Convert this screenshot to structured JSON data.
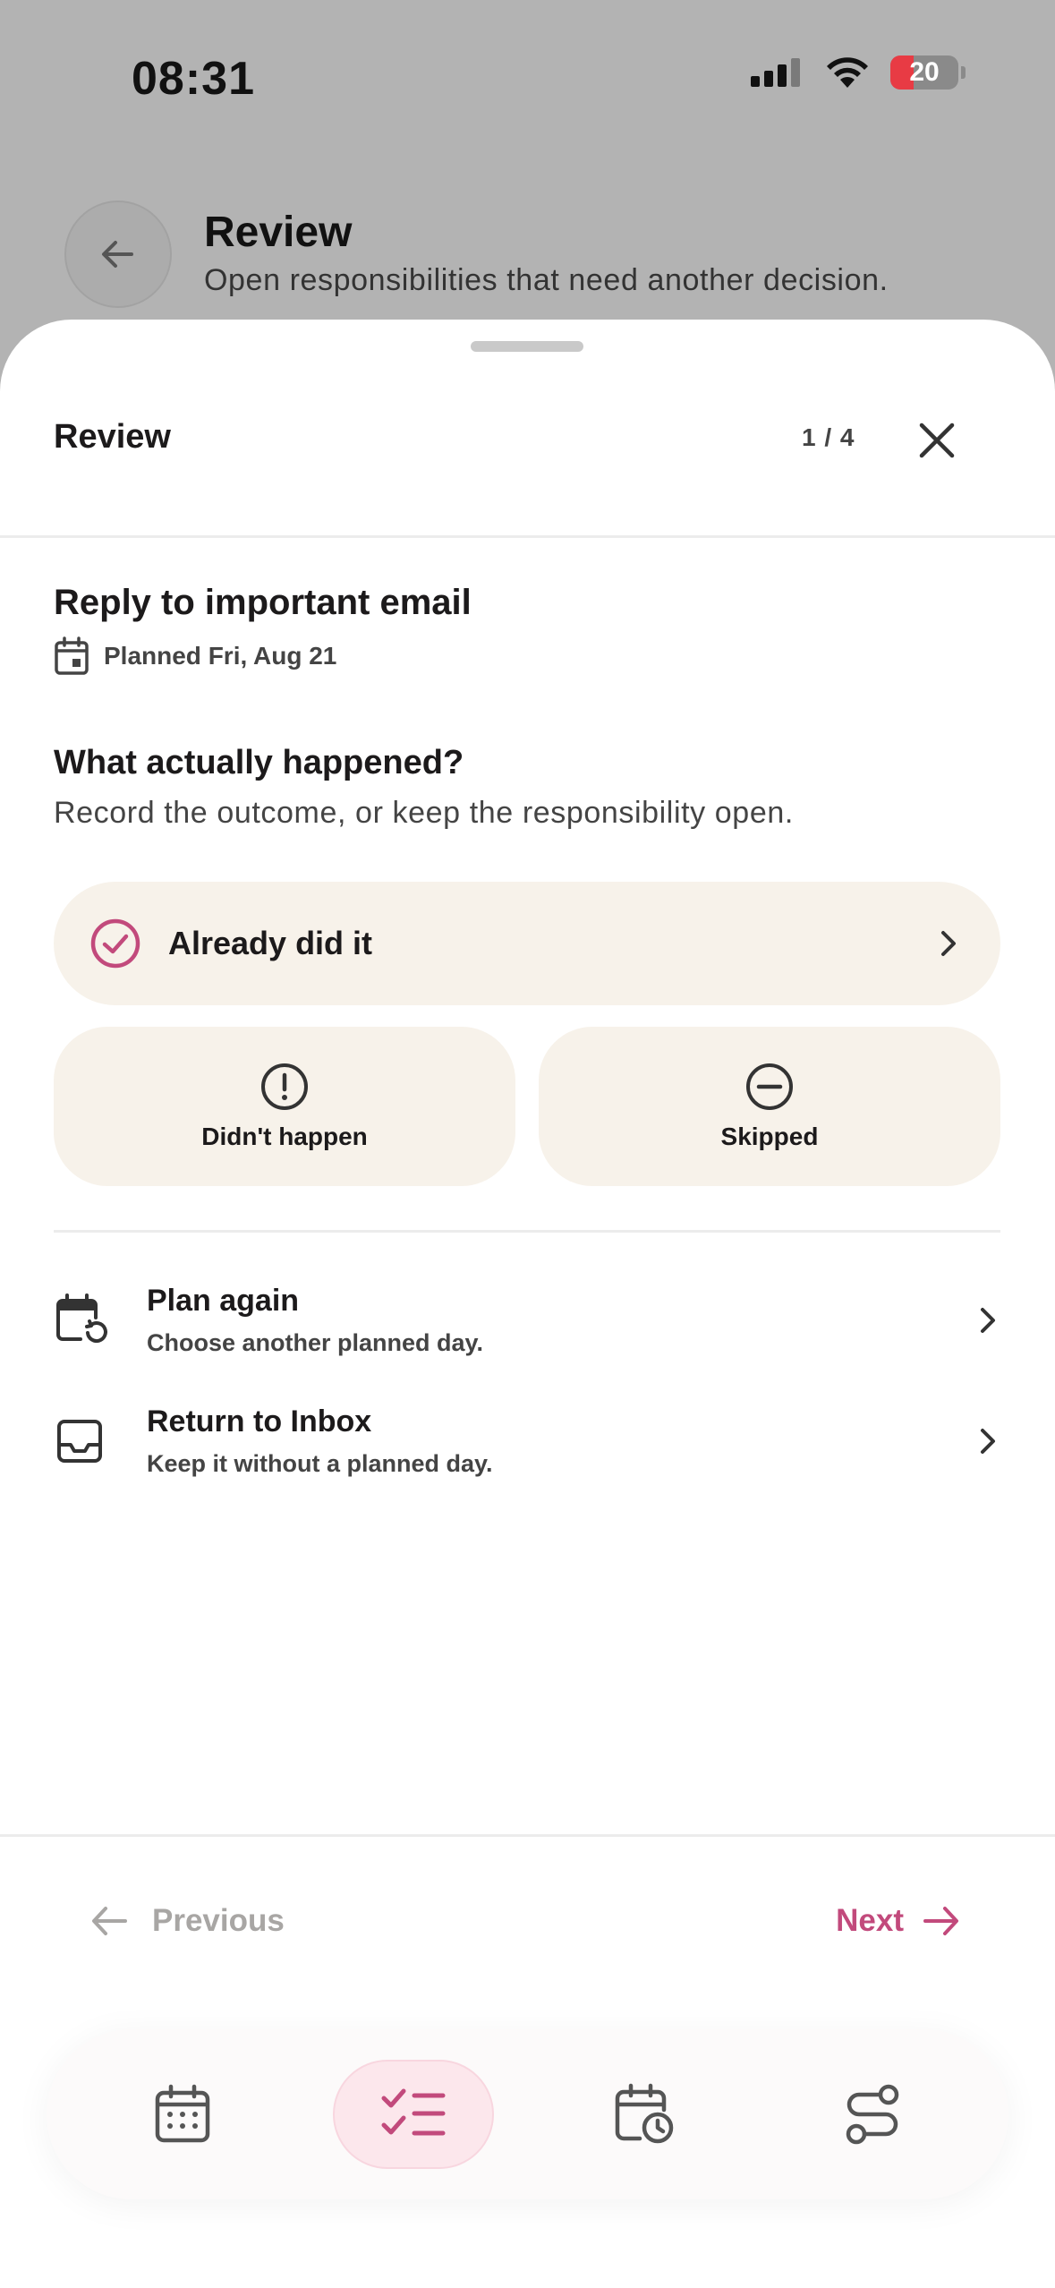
{
  "status": {
    "time": "08:31",
    "battery": "20"
  },
  "background": {
    "title": "Review",
    "subtitle": "Open responsibilities that need another decision."
  },
  "sheet": {
    "title": "Review",
    "counter": "1 / 4",
    "task": {
      "title": "Reply to important email",
      "planned": "Planned Fri, Aug 21"
    },
    "question": "What actually happened?",
    "question_sub": "Record the outcome, or keep the responsibility open.",
    "outcomes": {
      "done": "Already did it",
      "didnt": "Didn't happen",
      "skipped": "Skipped"
    },
    "actions": [
      {
        "title": "Plan again",
        "subtitle": "Choose another planned day."
      },
      {
        "title": "Return to Inbox",
        "subtitle": "Keep it without a planned day."
      }
    ],
    "nav": {
      "previous": "Previous",
      "next": "Next"
    }
  },
  "colors": {
    "accent": "#c24a7c",
    "card": "#f7f2ea",
    "tab_active": "#fce7ec"
  },
  "tabs": [
    {
      "icon": "calendar-grid-icon",
      "active": false
    },
    {
      "icon": "checklist-icon",
      "active": true
    },
    {
      "icon": "calendar-clock-icon",
      "active": false
    },
    {
      "icon": "route-settings-icon",
      "active": false
    }
  ]
}
